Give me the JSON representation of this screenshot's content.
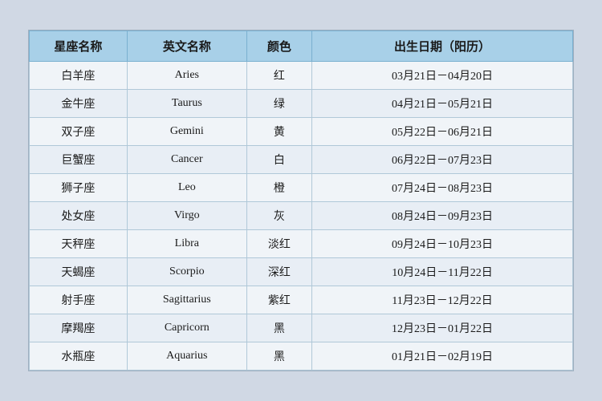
{
  "table": {
    "headers": [
      {
        "id": "zh-name",
        "label": "星座名称"
      },
      {
        "id": "en-name",
        "label": "英文名称"
      },
      {
        "id": "color",
        "label": "颜色"
      },
      {
        "id": "date",
        "label": "出生日期（阳历）"
      }
    ],
    "rows": [
      {
        "zh": "白羊座",
        "en": "Aries",
        "color": "红",
        "date": "03月21日－04月20日"
      },
      {
        "zh": "金牛座",
        "en": "Taurus",
        "color": "绿",
        "date": "04月21日－05月21日"
      },
      {
        "zh": "双子座",
        "en": "Gemini",
        "color": "黄",
        "date": "05月22日－06月21日"
      },
      {
        "zh": "巨蟹座",
        "en": "Cancer",
        "color": "白",
        "date": "06月22日－07月23日"
      },
      {
        "zh": "狮子座",
        "en": "Leo",
        "color": "橙",
        "date": "07月24日－08月23日"
      },
      {
        "zh": "处女座",
        "en": "Virgo",
        "color": "灰",
        "date": "08月24日－09月23日"
      },
      {
        "zh": "天秤座",
        "en": "Libra",
        "color": "淡红",
        "date": "09月24日－10月23日"
      },
      {
        "zh": "天蝎座",
        "en": "Scorpio",
        "color": "深红",
        "date": "10月24日－11月22日"
      },
      {
        "zh": "射手座",
        "en": "Sagittarius",
        "color": "紫红",
        "date": "11月23日－12月22日"
      },
      {
        "zh": "摩羯座",
        "en": "Capricorn",
        "color": "黑",
        "date": "12月23日－01月22日"
      },
      {
        "zh": "水瓶座",
        "en": "Aquarius",
        "color": "黑",
        "date": "01月21日－02月19日"
      }
    ]
  }
}
